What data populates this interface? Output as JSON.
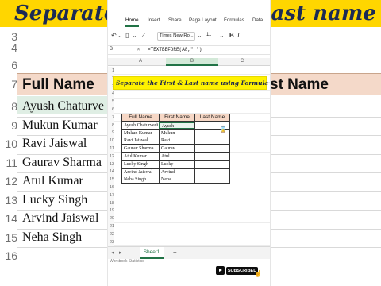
{
  "background": {
    "banner_text": "Separate the First & Last name using Formula",
    "top_rownums": [
      "3",
      "4",
      "5",
      "6"
    ],
    "header_row_num": "7",
    "header_full_name": "Full Name",
    "header_last_name": "st Name",
    "rows": [
      {
        "num": "8",
        "name": "Ayush Chaturve"
      },
      {
        "num": "9",
        "name": "Mukun Kumar"
      },
      {
        "num": "10",
        "name": "Ravi Jaiswal"
      },
      {
        "num": "11",
        "name": "Gaurav Sharma"
      },
      {
        "num": "12",
        "name": "Atul Kumar"
      },
      {
        "num": "13",
        "name": "Lucky Singh"
      },
      {
        "num": "14",
        "name": "Arvind Jaiswal"
      },
      {
        "num": "15",
        "name": "Neha Singh"
      }
    ],
    "bottom_rownums": [
      "16"
    ]
  },
  "ribbon": {
    "tabs": [
      "Home",
      "Insert",
      "Share",
      "Page Layout",
      "Formulas",
      "Data"
    ],
    "active_tab": "Home"
  },
  "toolbar": {
    "font_name": "Times New Ro...",
    "font_size": "11",
    "bold": "B",
    "italic": "I"
  },
  "formula_bar": {
    "cell_ref": "B",
    "formula": "=TEXTBEFORE(A8,\" \")"
  },
  "columns": [
    "A",
    "B",
    "C"
  ],
  "row_numbers": [
    "1",
    "2",
    "3",
    "4",
    "5",
    "6",
    "7",
    "8",
    "9",
    "10",
    "11",
    "12",
    "13",
    "14",
    "15",
    "16",
    "17",
    "18",
    "19",
    "20",
    "21",
    "22",
    "23"
  ],
  "callout": "Separate the First & Last name using Formula",
  "table": {
    "headers": [
      "Full Name",
      "First Name",
      "Last Name"
    ],
    "rows": [
      {
        "full": "Ayush Chaturvedi",
        "first": "Ayush",
        "last": ""
      },
      {
        "full": "Mukun Kumar",
        "first": "Mukun",
        "last": ""
      },
      {
        "full": "Ravi Jaiswal",
        "first": "Ravi",
        "last": ""
      },
      {
        "full": "Gaurav Sharma",
        "first": "Gaurav",
        "last": ""
      },
      {
        "full": "Atul Kumar",
        "first": "Atul",
        "last": ""
      },
      {
        "full": "Lucky Singh",
        "first": "Lucky",
        "last": ""
      },
      {
        "full": "Arvind Jaiswal",
        "first": "Arvind",
        "last": ""
      },
      {
        "full": "Neha Singh",
        "first": "Neha",
        "last": ""
      }
    ]
  },
  "sheet_tabs": [
    "Sheet1"
  ],
  "status_text": "Workbook Statistics",
  "subscribe_label": "SUBSCRIBED",
  "colors": {
    "accent": "#217346",
    "banner": "#ffd600",
    "callout": "#fff200",
    "header_fill": "#f6d7c5"
  }
}
